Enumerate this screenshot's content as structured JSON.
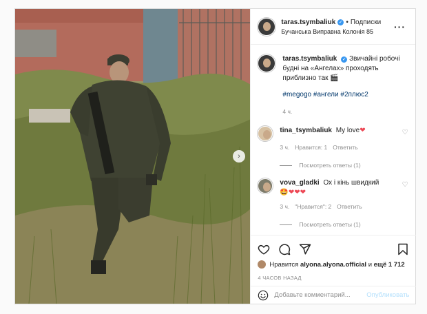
{
  "post": {
    "photo": {
      "alt_icon": "photo",
      "next_icon": "chevron-right-icon"
    },
    "header": {
      "username": "taras.tsymbaliuk",
      "verified_icon": "verified-badge-icon",
      "separator": "•",
      "follow_label": "Подписки",
      "location": "Бучанська Виправна Колонія 85",
      "more_icon": "more-options-icon"
    },
    "caption": {
      "username": "taras.tsymbaliuk",
      "text": "Звичайні робочі будні на «Ангелах» проходять приблизно так 🎬",
      "hashtags": "#megogo #ангели #2плюс2",
      "time": "4 ч."
    },
    "comments": [
      {
        "username": "tina_tsymbaliuk",
        "text": "My love",
        "emoji": "❤",
        "time": "3 ч.",
        "likes": "Нравится: 1",
        "reply_label": "Ответить",
        "view_replies": "Посмотреть ответы (1)"
      },
      {
        "username": "vova_gladki",
        "text": "Ох і кінь швидкий",
        "emoji": "🤩❤❤❤",
        "time": "3 ч.",
        "likes": "\"Нравится\": 2",
        "reply_label": "Ответить",
        "view_replies": "Посмотреть ответы (1)"
      }
    ],
    "actions": {
      "like_icon": "heart-icon",
      "comment_icon": "comment-icon",
      "share_icon": "share-icon",
      "save_icon": "bookmark-icon",
      "liked_by_prefix": "Нравится",
      "liked_by_user": "alyona.alyona.official",
      "liked_by_middle": "и",
      "liked_by_others": "ещё 1 712",
      "time_ago": "4 ЧАСОВ НАЗАД"
    },
    "add_comment": {
      "emoji_icon": "emoji-icon",
      "placeholder": "Добавьте комментарий...",
      "publish_label": "Опубликовать"
    }
  },
  "colors": {
    "link": "#00376b",
    "verified": "#3897f0",
    "heart": "#ed4956",
    "publish_disabled": "#b2dffc"
  }
}
